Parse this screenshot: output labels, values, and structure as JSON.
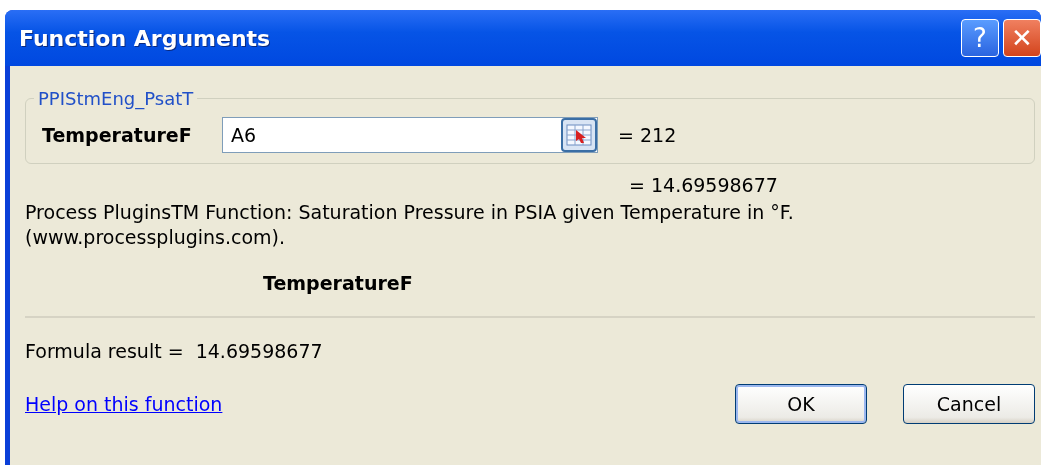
{
  "window": {
    "title": "Function Arguments",
    "title_buttons": [
      {
        "kind": "help",
        "label": "?"
      },
      {
        "kind": "close",
        "label": "✕"
      }
    ]
  },
  "function_group": {
    "name": "PPIStmEng_PsatT",
    "arguments": [
      {
        "label": "TemperatureF",
        "value": "A6",
        "result": "= 212"
      }
    ]
  },
  "function_result": "= 14.69598677",
  "description": "Process PluginsTM Function: Saturation Pressure in PSIA given Temperature in °F. (www.processplugins.com).",
  "argument_help": "TemperatureF",
  "formula_result": {
    "label": "Formula result =",
    "value": "14.69598677"
  },
  "help_link": "Help on this function",
  "buttons": [
    {
      "label": "OK",
      "default": true
    },
    {
      "label": "Cancel",
      "default": false
    }
  ]
}
